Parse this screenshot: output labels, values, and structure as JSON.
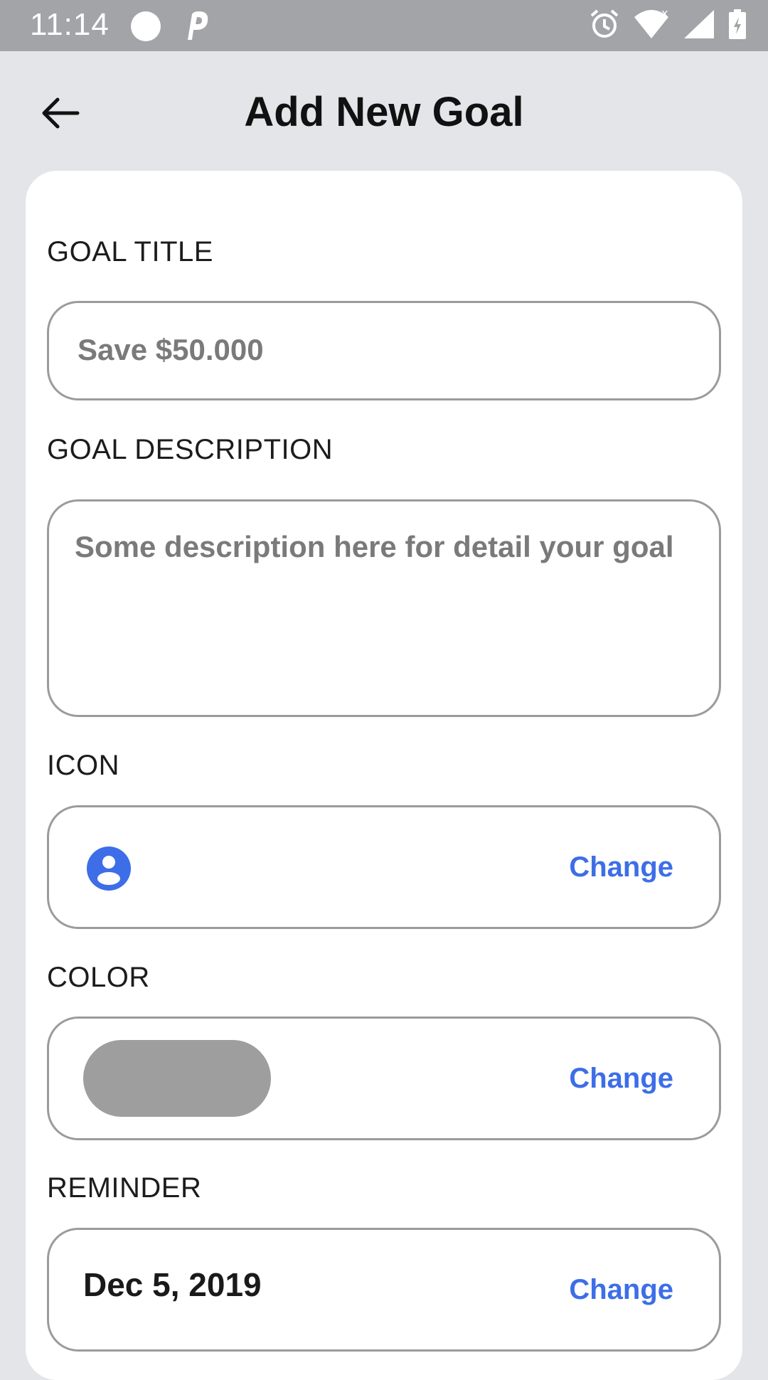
{
  "status_bar": {
    "time": "11:14",
    "icons": [
      "circle-icon",
      "p-icon",
      "alarm-icon",
      "wifi-icon",
      "signal-icon",
      "battery-icon"
    ]
  },
  "header": {
    "title": "Add New Goal",
    "back_icon": "arrow-left-icon"
  },
  "form": {
    "goal_title": {
      "label": "GOAL TITLE",
      "placeholder": "Save $50.000"
    },
    "goal_description": {
      "label": "GOAL DESCRIPTION",
      "placeholder": "Some description here for detail your goal"
    },
    "icon": {
      "label": "ICON",
      "selected_icon": "user-circle-icon",
      "icon_color": "#3d6ee8",
      "change_label": "Change"
    },
    "color": {
      "label": "COLOR",
      "selected_color": "#9e9e9e",
      "change_label": "Change"
    },
    "reminder": {
      "label": "REMINDER",
      "date": "Dec 5, 2019",
      "change_label": "Change"
    }
  },
  "colors": {
    "accent": "#3d6ee8",
    "background": "#e4e5e9",
    "card": "#ffffff",
    "status_bar": "#a3a4a8"
  }
}
